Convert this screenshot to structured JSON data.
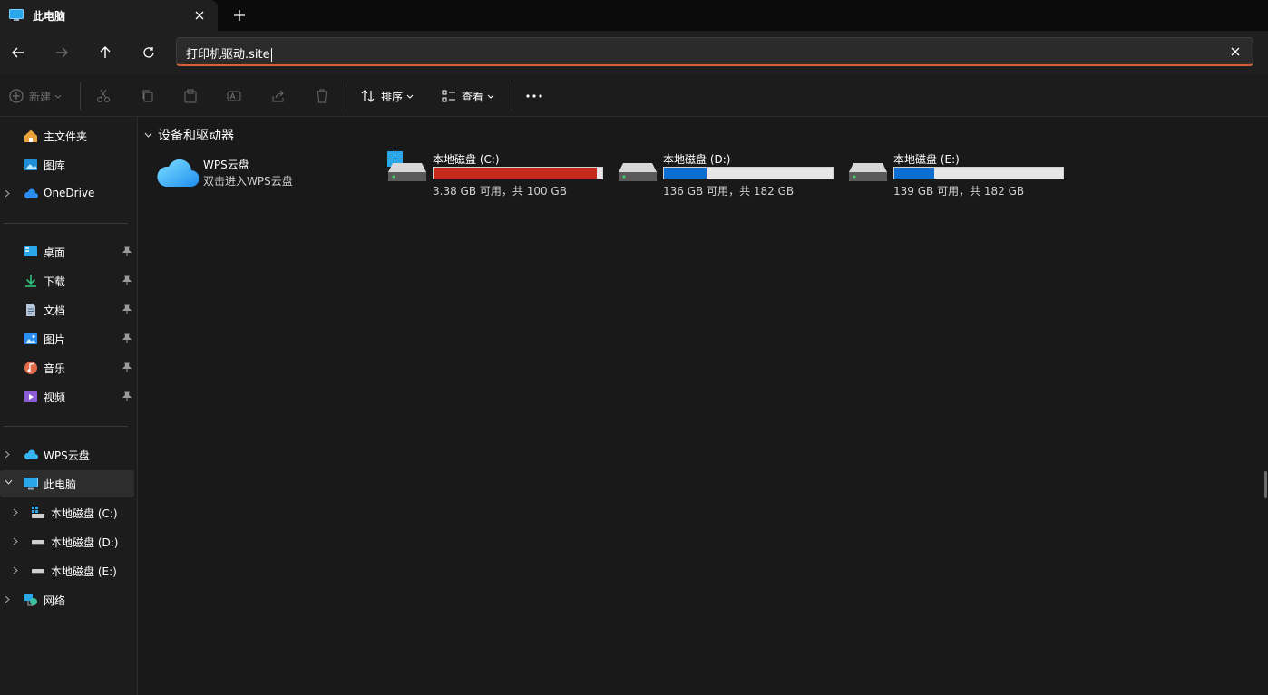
{
  "window": {
    "tab_title": "此电脑",
    "tab_icon": "pc-icon"
  },
  "address": {
    "value": "打印机驱动.site"
  },
  "toolbar": {
    "new_label": "新建",
    "sort_label": "排序",
    "view_label": "查看"
  },
  "sidebar": {
    "home": "主文件夹",
    "gallery": "图库",
    "onedrive": "OneDrive",
    "desktop": "桌面",
    "downloads": "下载",
    "documents": "文档",
    "pictures": "图片",
    "music": "音乐",
    "videos": "视频",
    "wps": "WPS云盘",
    "this_pc": "此电脑",
    "drive_c": "本地磁盘 (C:)",
    "drive_d": "本地磁盘 (D:)",
    "drive_e": "本地磁盘 (E:)",
    "network": "网络"
  },
  "content": {
    "group_title": "设备和驱动器",
    "wps_name": "WPS云盘",
    "wps_sub": "双击进入WPS云盘",
    "drives": [
      {
        "name": "本地磁盘 (C:)",
        "free_text": "3.38 GB 可用，共 100 GB",
        "used_fraction": 0.966,
        "bar_color": "#c42b1c",
        "system": true
      },
      {
        "name": "本地磁盘 (D:)",
        "free_text": "136 GB 可用，共 182 GB",
        "used_fraction": 0.253,
        "bar_color": "#0a6fd0",
        "system": false
      },
      {
        "name": "本地磁盘 (E:)",
        "free_text": "139 GB 可用，共 182 GB",
        "used_fraction": 0.236,
        "bar_color": "#0a6fd0",
        "system": false
      }
    ]
  },
  "colors": {
    "accent_underline": "#d9603b",
    "drive_low_space": "#c42b1c",
    "drive_normal": "#0a6fd0"
  }
}
